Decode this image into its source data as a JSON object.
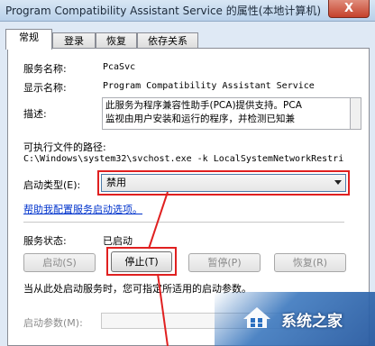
{
  "window": {
    "title": "Program Compatibility Assistant Service 的属性(本地计算机)",
    "close_glyph": "X"
  },
  "tabs": [
    {
      "label": "常规",
      "active": true
    },
    {
      "label": "登录",
      "active": false
    },
    {
      "label": "恢复",
      "active": false
    },
    {
      "label": "依存关系",
      "active": false
    }
  ],
  "general": {
    "service_name_label": "服务名称:",
    "service_name": "PcaSvc",
    "display_name_label": "显示名称:",
    "display_name": "Program Compatibility Assistant Service",
    "description_label": "描述:",
    "description_line1": "此服务为程序兼容性助手(PCA)提供支持。PCA",
    "description_line2": "监视由用户安装和运行的程序，并检测已知兼",
    "path_label": "可执行文件的路径:",
    "path_value": "C:\\Windows\\system32\\svchost.exe -k LocalSystemNetworkRestri",
    "startup_type_label": "启动类型(E):",
    "startup_type_value": "禁用",
    "help_link": "帮助我配置服务启动选项。",
    "status_label": "服务状态:",
    "status_value": "已启动",
    "buttons": {
      "start": "启动(S)",
      "stop": "停止(T)",
      "pause": "暂停(P)",
      "resume": "恢复(R)"
    },
    "hint": "当从此处启动服务时，您可指定所适用的启动参数。",
    "params_label": "启动参数(M):",
    "params_value": ""
  },
  "watermark": {
    "text": "系统之家"
  },
  "colors": {
    "highlight_red": "#e02020",
    "link_blue": "#0033cc"
  }
}
